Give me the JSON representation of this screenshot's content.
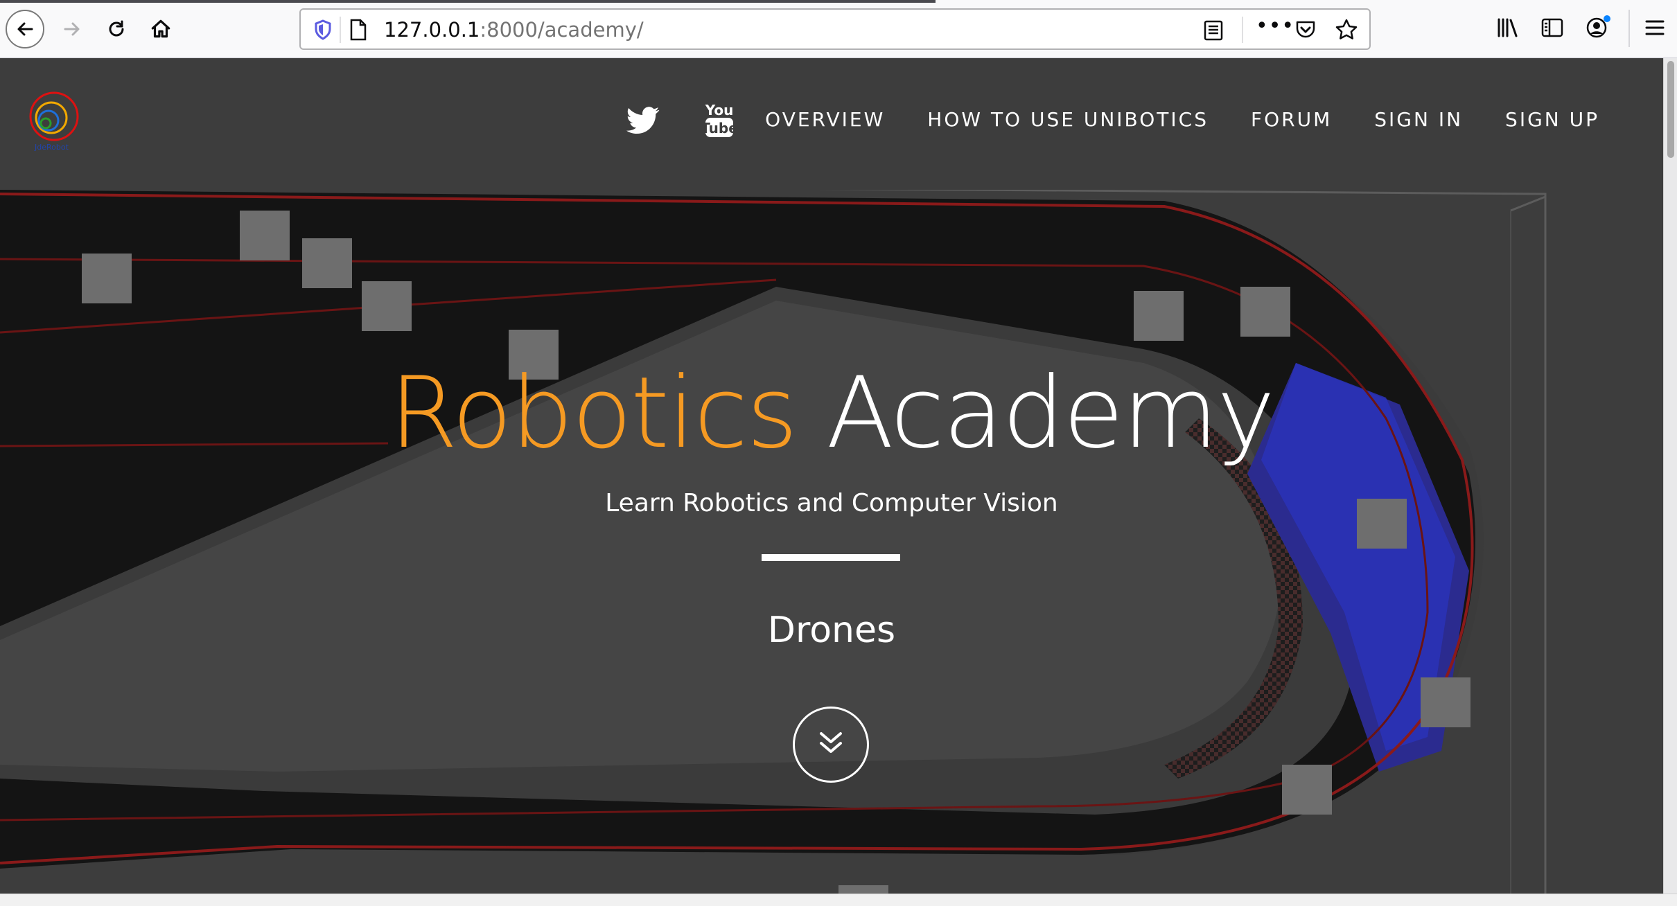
{
  "browser": {
    "url_host": "127.0.0.1",
    "url_rest": ":8000/academy/",
    "more_label": "•••",
    "icons": [
      "back-icon",
      "forward-icon",
      "reload-icon",
      "home-icon",
      "shield-icon",
      "page-icon",
      "reader-view-icon",
      "more-icon",
      "pocket-icon",
      "star-icon",
      "library-icon",
      "sidebar-icon",
      "account-icon",
      "menu-icon"
    ]
  },
  "site": {
    "logo_text": "JdeRobot",
    "nav": {
      "social_icons": [
        "twitter-icon",
        "youtube-icon"
      ],
      "youtube_top": "You",
      "youtube_bottom": "Tube",
      "links": [
        "OVERVIEW",
        "HOW TO USE UNIBOTICS",
        "FORUM",
        "SIGN IN",
        "SIGN UP"
      ]
    },
    "hero": {
      "title_word1": "Robotics",
      "title_word2": "Academy",
      "subtitle": "Learn Robotics and Computer Vision",
      "rotating_text": "Drones",
      "colors": {
        "accent": "#f59a23",
        "text": "#ffffff",
        "navbar_bg": "#3d3d3d"
      }
    }
  }
}
